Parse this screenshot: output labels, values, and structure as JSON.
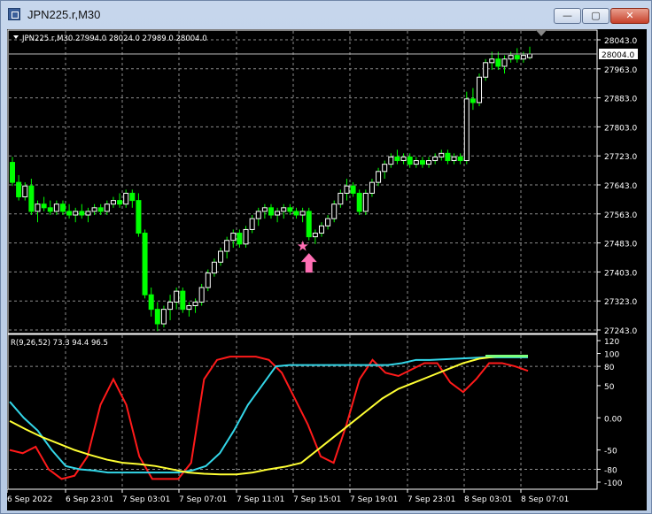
{
  "window": {
    "title": "JPN225.r,M30",
    "min_symbol": "—",
    "max_symbol": "▢",
    "close_symbol": "✕"
  },
  "main_panel": {
    "info": "JPN225.r,M30  27994.0 28024.0 27989.0 28004.0",
    "bid_label": "28004.0",
    "price_ticks": [
      "28043.0",
      "27963.0",
      "27883.0",
      "27803.0",
      "27723.0",
      "27643.0",
      "27563.0",
      "27483.0",
      "27403.0",
      "27323.0",
      "27243.0"
    ]
  },
  "indicator": {
    "info": "R(9,26,52) 73.3 94.4 96.5",
    "ticks": [
      "120",
      "100",
      "80",
      "50",
      "0.00",
      "-50",
      "-80",
      "-100"
    ]
  },
  "time_axis": [
    "6 Sep 2022",
    "6 Sep 23:01",
    "7 Sep 03:01",
    "7 Sep 07:01",
    "7 Sep 11:01",
    "7 Sep 15:01",
    "7 Sep 19:01",
    "7 Sep 23:01",
    "8 Sep 03:01",
    "8 Sep 07:01"
  ],
  "colors": {
    "background": "#000000",
    "bull_candle": "#ffffff",
    "bear_candle": "#00ff00",
    "grid": "#8c8c8c",
    "line_red": "#ff1a1a",
    "line_cyan": "#33d6e8",
    "line_yellow": "#ffff33",
    "line_green": "#7dff7d",
    "marker": "#ff6eb4"
  },
  "chart_data": [
    {
      "type": "candlestick",
      "title": "JPN225.r,M30",
      "last": {
        "open": 27994.0,
        "high": 28024.0,
        "low": 27989.0,
        "close": 28004.0
      },
      "ylim": [
        27243,
        28043
      ],
      "candles": [
        [
          27705,
          27720,
          27640,
          27650
        ],
        [
          27650,
          27670,
          27600,
          27610
        ],
        [
          27610,
          27650,
          27600,
          27640
        ],
        [
          27640,
          27660,
          27560,
          27570
        ],
        [
          27570,
          27600,
          27540,
          27590
        ],
        [
          27590,
          27610,
          27570,
          27580
        ],
        [
          27580,
          27600,
          27560,
          27570
        ],
        [
          27570,
          27600,
          27560,
          27590
        ],
        [
          27590,
          27600,
          27560,
          27570
        ],
        [
          27570,
          27590,
          27550,
          27560
        ],
        [
          27560,
          27580,
          27540,
          27570
        ],
        [
          27570,
          27590,
          27550,
          27560
        ],
        [
          27560,
          27580,
          27540,
          27570
        ],
        [
          27570,
          27590,
          27560,
          27580
        ],
        [
          27580,
          27590,
          27560,
          27570
        ],
        [
          27570,
          27600,
          27560,
          27590
        ],
        [
          27590,
          27610,
          27580,
          27600
        ],
        [
          27600,
          27620,
          27580,
          27590
        ],
        [
          27590,
          27630,
          27580,
          27620
        ],
        [
          27620,
          27630,
          27580,
          27600
        ],
        [
          27600,
          27620,
          27500,
          27510
        ],
        [
          27510,
          27520,
          27330,
          27340
        ],
        [
          27340,
          27360,
          27280,
          27300
        ],
        [
          27300,
          27320,
          27240,
          27260
        ],
        [
          27260,
          27310,
          27250,
          27300
        ],
        [
          27300,
          27340,
          27270,
          27320
        ],
        [
          27320,
          27360,
          27300,
          27350
        ],
        [
          27350,
          27360,
          27290,
          27300
        ],
        [
          27300,
          27320,
          27280,
          27310
        ],
        [
          27310,
          27330,
          27290,
          27320
        ],
        [
          27320,
          27370,
          27310,
          27360
        ],
        [
          27360,
          27410,
          27350,
          27400
        ],
        [
          27400,
          27440,
          27390,
          27430
        ],
        [
          27430,
          27470,
          27420,
          27460
        ],
        [
          27460,
          27500,
          27440,
          27490
        ],
        [
          27490,
          27520,
          27470,
          27510
        ],
        [
          27510,
          27520,
          27470,
          27480
        ],
        [
          27480,
          27530,
          27470,
          27520
        ],
        [
          27520,
          27560,
          27510,
          27550
        ],
        [
          27550,
          27580,
          27530,
          27570
        ],
        [
          27570,
          27590,
          27550,
          27580
        ],
        [
          27580,
          27590,
          27550,
          27560
        ],
        [
          27560,
          27580,
          27540,
          27570
        ],
        [
          27570,
          27590,
          27550,
          27580
        ],
        [
          27580,
          27590,
          27560,
          27570
        ],
        [
          27570,
          27580,
          27550,
          27560
        ],
        [
          27560,
          27580,
          27540,
          27570
        ],
        [
          27570,
          27580,
          27490,
          27500
        ],
        [
          27500,
          27520,
          27480,
          27510
        ],
        [
          27510,
          27540,
          27500,
          27530
        ],
        [
          27530,
          27560,
          27520,
          27550
        ],
        [
          27550,
          27600,
          27540,
          27590
        ],
        [
          27590,
          27630,
          27580,
          27620
        ],
        [
          27620,
          27660,
          27600,
          27640
        ],
        [
          27640,
          27650,
          27610,
          27620
        ],
        [
          27620,
          27630,
          27560,
          27570
        ],
        [
          27570,
          27630,
          27560,
          27620
        ],
        [
          27620,
          27660,
          27610,
          27650
        ],
        [
          27650,
          27690,
          27640,
          27680
        ],
        [
          27680,
          27710,
          27660,
          27700
        ],
        [
          27700,
          27730,
          27690,
          27720
        ],
        [
          27720,
          27740,
          27700,
          27710
        ],
        [
          27710,
          27730,
          27700,
          27720
        ],
        [
          27720,
          27730,
          27690,
          27700
        ],
        [
          27700,
          27720,
          27690,
          27710
        ],
        [
          27710,
          27720,
          27690,
          27700
        ],
        [
          27700,
          27720,
          27690,
          27710
        ],
        [
          27710,
          27730,
          27700,
          27720
        ],
        [
          27720,
          27740,
          27710,
          27730
        ],
        [
          27730,
          27740,
          27700,
          27710
        ],
        [
          27710,
          27730,
          27700,
          27720
        ],
        [
          27720,
          27730,
          27700,
          27710
        ],
        [
          27710,
          27900,
          27700,
          27880
        ],
        [
          27880,
          27910,
          27850,
          27870
        ],
        [
          27870,
          27950,
          27860,
          27940
        ],
        [
          27940,
          27990,
          27930,
          27980
        ],
        [
          27980,
          28010,
          27960,
          27990
        ],
        [
          27990,
          28010,
          27960,
          27970
        ],
        [
          27970,
          28000,
          27950,
          27990
        ],
        [
          27990,
          28010,
          27980,
          28000
        ],
        [
          28000,
          28020,
          27980,
          27990
        ],
        [
          27990,
          28010,
          27980,
          28000
        ],
        [
          27994,
          28024,
          27989,
          28004
        ]
      ],
      "annotations": [
        {
          "type": "star",
          "index": 46,
          "price": 27476
        },
        {
          "type": "up-arrow",
          "index": 47,
          "price": 27455
        }
      ]
    },
    {
      "type": "line",
      "title": "R(9,26,52) 73.3 94.4 96.5",
      "ylim": [
        -100,
        120
      ],
      "series": [
        {
          "name": "R(9)",
          "values": [
            -50,
            -55,
            -45,
            -80,
            -95,
            -90,
            -60,
            20,
            60,
            20,
            -60,
            -95,
            -95,
            -95,
            -70,
            60,
            90,
            95,
            95,
            95,
            90,
            70,
            30,
            -10,
            -60,
            -70,
            -10,
            60,
            90,
            70,
            65,
            75,
            85,
            85,
            55,
            40,
            60,
            85,
            85,
            80,
            73
          ]
        },
        {
          "name": "R(26)",
          "values": [
            25,
            0,
            -20,
            -50,
            -75,
            -80,
            -82,
            -85,
            -85,
            -85,
            -85,
            -85,
            -85,
            -82,
            -75,
            -55,
            -20,
            20,
            50,
            80,
            82,
            82,
            82,
            82,
            82,
            82,
            82,
            82,
            85,
            90,
            90,
            91,
            92,
            93,
            94,
            94,
            94,
            94
          ]
        },
        {
          "name": "R(52)",
          "values": [
            -5,
            -18,
            -30,
            -40,
            -50,
            -58,
            -65,
            -70,
            -72,
            -75,
            -80,
            -85,
            -87,
            -88,
            -88,
            -85,
            -80,
            -76,
            -70,
            -50,
            -30,
            -10,
            10,
            30,
            45,
            55,
            65,
            75,
            85,
            92,
            95,
            96,
            96.5
          ]
        },
        {
          "name": "",
          "values": [
            96,
            96,
            96,
            96,
            96,
            96,
            96
          ]
        }
      ]
    }
  ]
}
